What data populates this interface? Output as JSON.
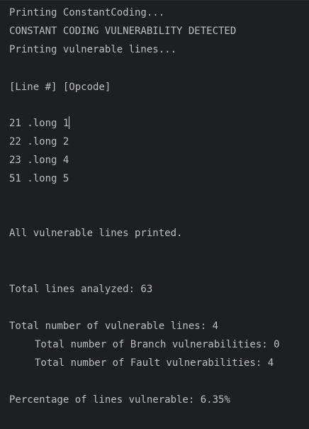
{
  "console": {
    "header": [
      "Printing ConstantCoding...",
      "CONSTANT CODING VULNERABILITY DETECTED",
      "Printing vulnerable lines..."
    ],
    "columns_header": "[Line #] [Opcode]",
    "vulnerable_lines": [
      "21 .long 1",
      "22 .long 2",
      "23 .long 4",
      "51 .long 5"
    ],
    "all_printed": "All vulnerable lines printed.",
    "total_analyzed": "Total lines analyzed: 63",
    "total_vulnerable": "Total number of vulnerable lines: 4",
    "branch_vulnerabilities": "Total number of Branch vulnerabilities: 0",
    "fault_vulnerabilities": "Total number of Fault vulnerabilities: 4",
    "percentage": "Percentage of lines vulnerable: 6.35%"
  }
}
